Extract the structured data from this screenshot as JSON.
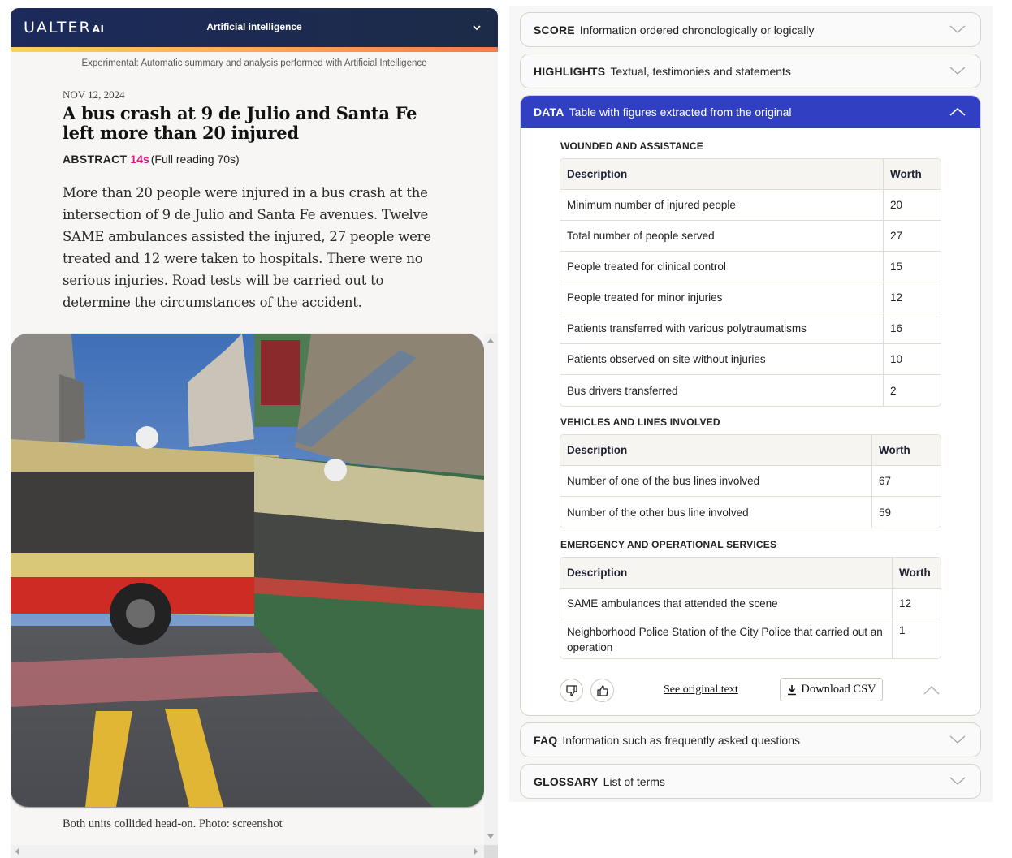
{
  "left": {
    "brand": {
      "logo_main": "UALTER",
      "logo_suffix": "AI"
    },
    "topbar_title": "Artificial intelligence",
    "experimental_notice": "Experimental: Automatic summary and analysis performed with Artificial Intelligence",
    "article": {
      "date": "NOV 12, 2024",
      "headline": "A bus crash at 9 de Julio and Santa Fe left more than 20 injured",
      "abstract_label": "ABSTRACT",
      "abstract_time": "14s",
      "full_reading": "(Full reading 70s)",
      "summary": "More than 20 people were injured in a bus crash at the intersection of 9 de Julio and Santa Fe avenues. Twelve SAME ambulances assisted the injured, 27 people were treated and 12 were taken to hospitals. There were no serious injuries. Road tests will be carried out to determine the circumstances of the accident.",
      "photo_alt": "Two buses collided at an intersection",
      "caption": "Both units collided head-on. Photo: screenshot"
    }
  },
  "right": {
    "accordions": [
      {
        "key": "SCORE",
        "desc": "Information ordered chronologically or logically",
        "open": false
      },
      {
        "key": "HIGHLIGHTS",
        "desc": "Textual, testimonies and statements",
        "open": false
      },
      {
        "key": "DATA",
        "desc": "Table with figures extracted from the original",
        "open": true
      },
      {
        "key": "FAQ",
        "desc": "Information such as frequently asked questions",
        "open": false
      },
      {
        "key": "GLOSSARY",
        "desc": "List of terms",
        "open": false
      }
    ],
    "data_sections": [
      {
        "title": "WOUNDED AND ASSISTANCE",
        "headers": [
          "Description",
          "Worth"
        ],
        "rows": [
          [
            "Minimum number of injured people",
            "20"
          ],
          [
            "Total number of people served",
            "27"
          ],
          [
            "People treated for clinical control",
            "15"
          ],
          [
            "People treated for minor injuries",
            "12"
          ],
          [
            "Patients transferred with various polytraumatisms",
            "16"
          ],
          [
            "Patients observed on site without injuries",
            "10"
          ],
          [
            "Bus drivers transferred",
            "2"
          ]
        ]
      },
      {
        "title": "VEHICLES AND LINES INVOLVED",
        "headers": [
          "Description",
          "Worth"
        ],
        "rows": [
          [
            "Number of one of the bus lines involved",
            "67"
          ],
          [
            "Number of the other bus line involved",
            "59"
          ]
        ]
      },
      {
        "title": "EMERGENCY AND OPERATIONAL SERVICES",
        "headers": [
          "Description",
          "Worth"
        ],
        "rows": [
          [
            "SAME ambulances that attended the scene",
            "12"
          ],
          [
            "Neighborhood Police Station of the City Police that carried out an operation",
            "1"
          ]
        ]
      }
    ],
    "actions": {
      "see_original": "See original text",
      "download_csv": "Download CSV"
    }
  },
  "colors": {
    "topbar": "#1c2a5c",
    "accent_pink": "#e0157e",
    "data_header": "#3140c2",
    "gradient_start": "#fdd35a",
    "gradient_end": "#f27a50"
  }
}
